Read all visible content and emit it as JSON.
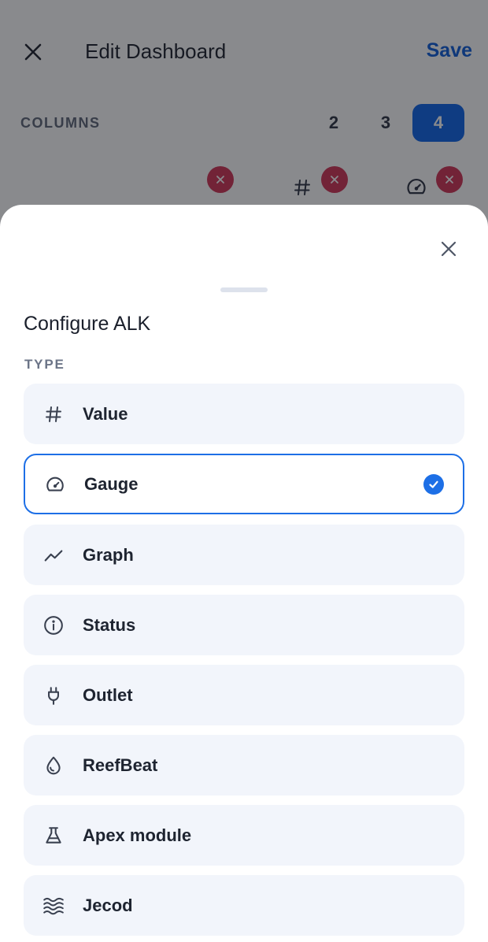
{
  "header": {
    "title": "Edit Dashboard",
    "save_label": "Save"
  },
  "columns": {
    "label": "COLUMNS",
    "options": [
      "2",
      "3",
      "4"
    ],
    "selected": "4"
  },
  "sheet": {
    "title": "Configure ALK",
    "section_label": "TYPE",
    "selected_type": "Gauge",
    "options": [
      {
        "label": "Value",
        "icon": "hash-icon"
      },
      {
        "label": "Gauge",
        "icon": "gauge-icon"
      },
      {
        "label": "Graph",
        "icon": "trend-line-icon"
      },
      {
        "label": "Status",
        "icon": "info-circle-icon"
      },
      {
        "label": "Outlet",
        "icon": "plug-icon"
      },
      {
        "label": "ReefBeat",
        "icon": "water-drop-icon"
      },
      {
        "label": "Apex module",
        "icon": "flask-icon"
      },
      {
        "label": "Jecod",
        "icon": "waves-icon"
      }
    ]
  },
  "colors": {
    "accent": "#1d6fe6",
    "save": "#0a5bd9",
    "remove": "#d13152",
    "option_bg": "#f2f5fb"
  }
}
